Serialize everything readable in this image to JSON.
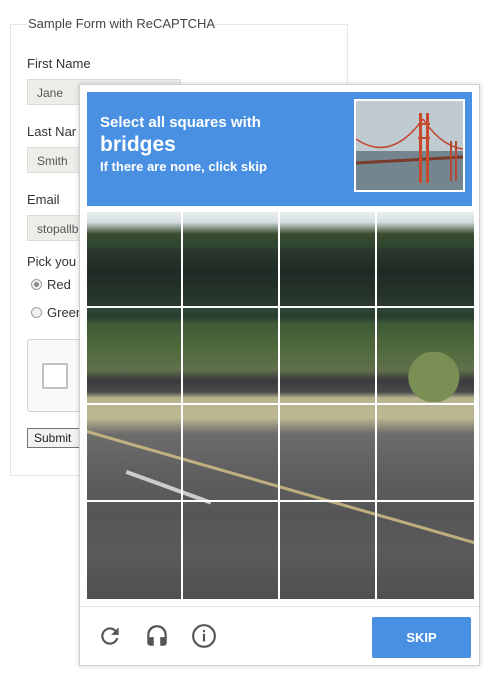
{
  "form": {
    "title": "Sample Form with ReCAPTCHA",
    "first_name_label": "First Name",
    "first_name_value": "Jane",
    "last_name_label": "Last Nar",
    "last_name_value": "Smith",
    "email_label": "Email",
    "email_value": "stopallb",
    "pick_label": "Pick you",
    "radio_options": [
      {
        "label": "Red",
        "checked": true
      },
      {
        "label": "Greer",
        "checked": false
      }
    ],
    "submit_label": "Submit"
  },
  "challenge": {
    "prompt_line1": "Select all squares with",
    "prompt_target": "bridges",
    "prompt_line3": "If there are none, click skip",
    "grid_rows": 4,
    "grid_cols": 4,
    "skip_label": "SKIP",
    "colors": {
      "accent": "#4a90e2",
      "icon": "#555555"
    },
    "footer_icons": [
      "reload-icon",
      "audio-icon",
      "info-icon"
    ]
  }
}
